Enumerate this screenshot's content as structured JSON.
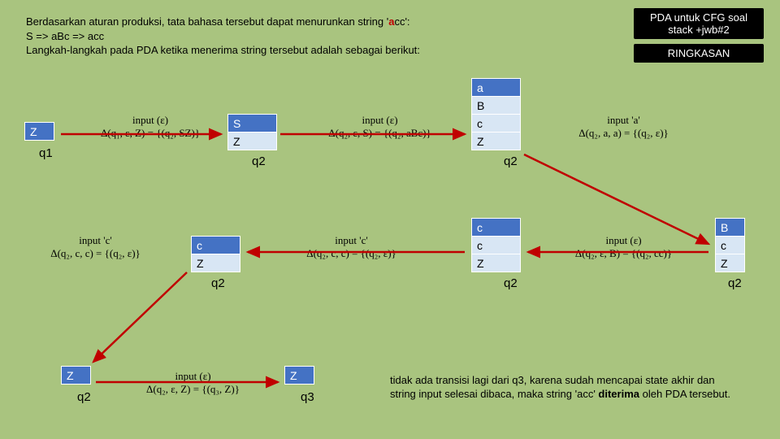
{
  "intro": {
    "l1a": "Berdasarkan aturan produksi, tata bahasa tersebut dapat menurunkan string '",
    "l1b": "a",
    "l1c": "cc':",
    "l2": "S => aBc => acc",
    "l3": "Langkah-langkah pada PDA ketika menerima string tersebut adalah sebagai berikut:"
  },
  "badges": {
    "top": "PDA untuk CFG soal stack +jwb#2",
    "sub": "RINGKASAN"
  },
  "stacks": {
    "s_q1": [
      "Z"
    ],
    "s_q2a": [
      "S",
      "Z"
    ],
    "s_q2b": [
      "a",
      "B",
      "c",
      "Z"
    ],
    "s_q2c": [
      "B",
      "c",
      "Z"
    ],
    "s_q2d": [
      "c",
      "c",
      "Z"
    ],
    "s_q2e": [
      "c",
      "Z"
    ],
    "s_q2f": [
      "Z"
    ],
    "s_q3": [
      "Z"
    ]
  },
  "headCells": {
    "s_q1": [
      0
    ],
    "s_q2a": [
      0
    ],
    "s_q2b": [
      0
    ],
    "s_q2c": [
      0
    ],
    "s_q2d": [
      0
    ],
    "s_q2e": [
      0
    ],
    "s_q2f": [
      0
    ],
    "s_q3": [
      0
    ]
  },
  "states": {
    "q1": "q1",
    "q2a": "q2",
    "q2b": "q2",
    "q2c": "q2",
    "q2d": "q2",
    "q2e": "q2",
    "q2f": "q2",
    "q3": "q3"
  },
  "formulas": {
    "f1_t": "input (ε)",
    "f1_d": "Δ(q₁, ε, Z) = {(q₂, SZ)}",
    "f2_t": "input (ε)",
    "f2_d": "Δ(q₂, ε, S) = {(q₂, aBc)}",
    "f3_t": "input 'a'",
    "f3_d": "Δ(q₂, a, a) = {(q₂, ε)}",
    "f4_t": "input (ε)",
    "f4_d": "Δ(q₂, ε, B) = {(q₂, cc)}",
    "f5_t": "input 'c'",
    "f5_d": "Δ(q₂, c, c) = {(q₂, ε)}",
    "f6_t": "input 'c'",
    "f6_d": "Δ(q₂, c, c) = {(q₂, ε)}",
    "f7_t": "input (ε)",
    "f7_d": "Δ(q₂, ε, Z) = {(q₃, Z)}"
  },
  "conclusion": {
    "pre": "tidak ada transisi lagi dari q3, karena sudah mencapai state akhir dan string input selesai dibaca, maka string 'acc' ",
    "bold": "diterima",
    "post": " oleh PDA tersebut."
  }
}
